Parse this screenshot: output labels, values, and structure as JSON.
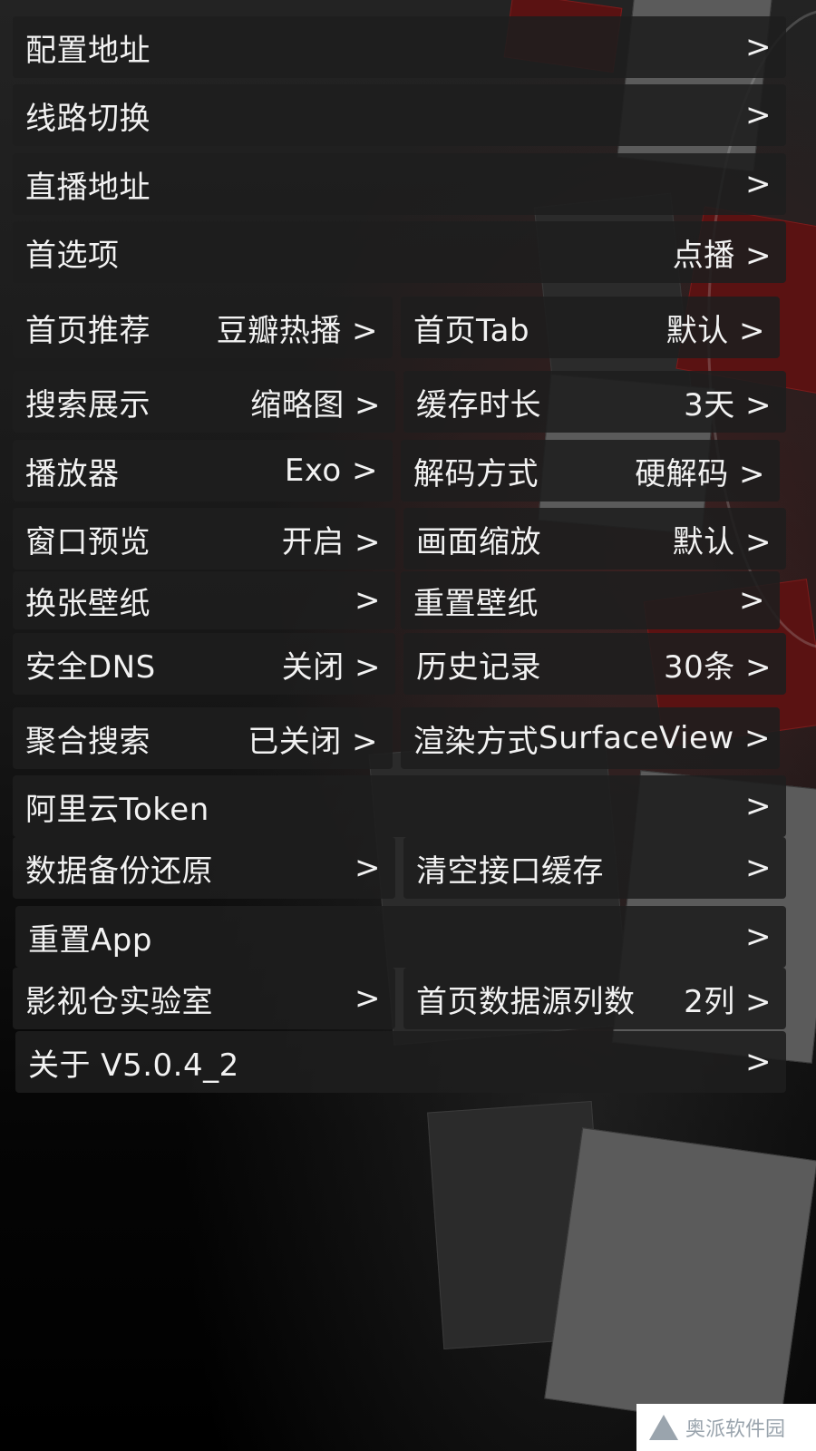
{
  "rows": [
    {
      "label": "配置地址",
      "value": ">"
    },
    {
      "label": "线路切换",
      "value": ">"
    },
    {
      "label": "直播地址",
      "value": ">"
    },
    {
      "label": "首选项",
      "value": "点播 >"
    },
    {
      "label": "首页推荐",
      "value": "豆瓣热播 >"
    },
    {
      "label": "首页Tab",
      "value": "默认 >"
    },
    {
      "label": "搜索展示",
      "value": "缩略图 >"
    },
    {
      "label": "缓存时长",
      "value": "3天 >"
    },
    {
      "label": "播放器",
      "value": "Exo >"
    },
    {
      "label": "解码方式",
      "value": "硬解码 >"
    },
    {
      "label": "窗口预览",
      "value": "开启 >"
    },
    {
      "label": "画面缩放",
      "value": "默认 >"
    },
    {
      "label": "换张壁纸",
      "value": ">"
    },
    {
      "label": "重置壁纸",
      "value": ">"
    },
    {
      "label": "安全DNS",
      "value": "关闭 >"
    },
    {
      "label": "历史记录",
      "value": "30条 >"
    },
    {
      "label": "聚合搜索",
      "value": "已关闭 >"
    },
    {
      "label": "渲染方式",
      "value": "SurfaceView >"
    },
    {
      "label": "阿里云Token",
      "value": ">"
    },
    {
      "label": "数据备份还原",
      "value": ">"
    },
    {
      "label": "清空接口缓存",
      "value": ">"
    },
    {
      "label": "重置App",
      "value": ">"
    },
    {
      "label": "影视仓实验室",
      "value": ">"
    },
    {
      "label": "首页数据源列数",
      "value": "2列 >"
    },
    {
      "label": "关于  V5.0.4_2",
      "value": ">"
    }
  ],
  "watermark": {
    "text": "奥派软件园"
  }
}
